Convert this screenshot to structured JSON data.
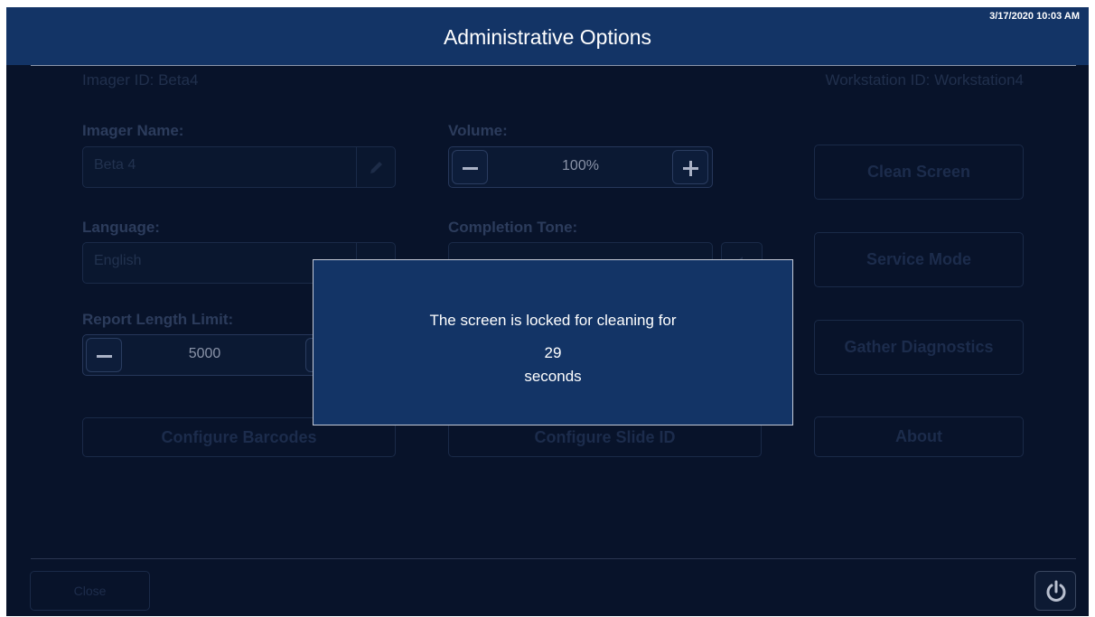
{
  "header": {
    "title": "Administrative Options",
    "datetime": "3/17/2020 10:03 AM"
  },
  "info": {
    "imager_id": "Imager ID: Beta4",
    "workstation_id": "Workstation ID: Workstation4"
  },
  "imager_name": {
    "label": "Imager Name:",
    "value": "Beta 4"
  },
  "language": {
    "label": "Language:",
    "value": "English"
  },
  "report_length": {
    "label": "Report Length Limit:",
    "value": "5000"
  },
  "volume": {
    "label": "Volume:",
    "value": "100%"
  },
  "completion_tone": {
    "label": "Completion Tone:",
    "value": ""
  },
  "buttons": {
    "clean_screen": "Clean Screen",
    "service_mode": "Service Mode",
    "gather_diagnostics": "Gather Diagnostics",
    "about": "About",
    "configure_barcodes": "Configure Barcodes",
    "configure_slide_id": "Configure Slide ID",
    "close": "Close"
  },
  "modal": {
    "line1": "The screen is locked for cleaning for",
    "seconds": "29",
    "line3": "seconds"
  },
  "icons": {
    "pencil": "pencil-icon",
    "minus": "minus-icon",
    "plus": "plus-icon",
    "power": "power-icon",
    "speaker": "speaker-icon",
    "chevron": "chevron-down-icon"
  },
  "colors": {
    "header": "#133466",
    "background": "#08132a",
    "modal": "#133466"
  }
}
